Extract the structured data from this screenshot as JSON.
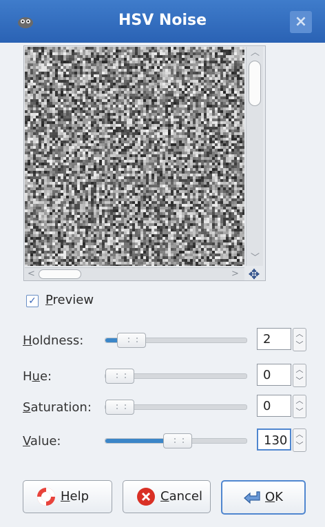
{
  "window": {
    "title": "HSV Noise",
    "close_glyph": "×"
  },
  "preview": {
    "checkbox_checked": true,
    "label_prefix": "",
    "label_mnemonic": "P",
    "label_rest": "review"
  },
  "sliders": [
    {
      "label_pre": "",
      "mnemonic": "H",
      "label_post": "oldness:",
      "value": "2",
      "level": 0.1
    },
    {
      "label_pre": "H",
      "mnemonic": "u",
      "label_post": "e:",
      "value": "0",
      "level": 0.0
    },
    {
      "label_pre": "",
      "mnemonic": "S",
      "label_post": "aturation:",
      "value": "0",
      "level": 0.0
    },
    {
      "label_pre": "",
      "mnemonic": "V",
      "label_post": "alue:",
      "value": "130",
      "level": 0.51
    }
  ],
  "buttons": {
    "help": {
      "mnemonic": "H",
      "rest": "elp"
    },
    "cancel": {
      "mnemonic": "C",
      "rest": "ancel"
    },
    "ok": {
      "mnemonic": "O",
      "rest": "K"
    }
  },
  "colors": {
    "titlebar": "#2f6bbf",
    "accent": "#3b86c8"
  },
  "icons": {
    "app": "gimp-icon",
    "help": "lifebuoy-icon",
    "cancel": "cancel-x-icon",
    "ok": "ok-arrow-icon",
    "navigate": "navigate-cross-icon"
  }
}
